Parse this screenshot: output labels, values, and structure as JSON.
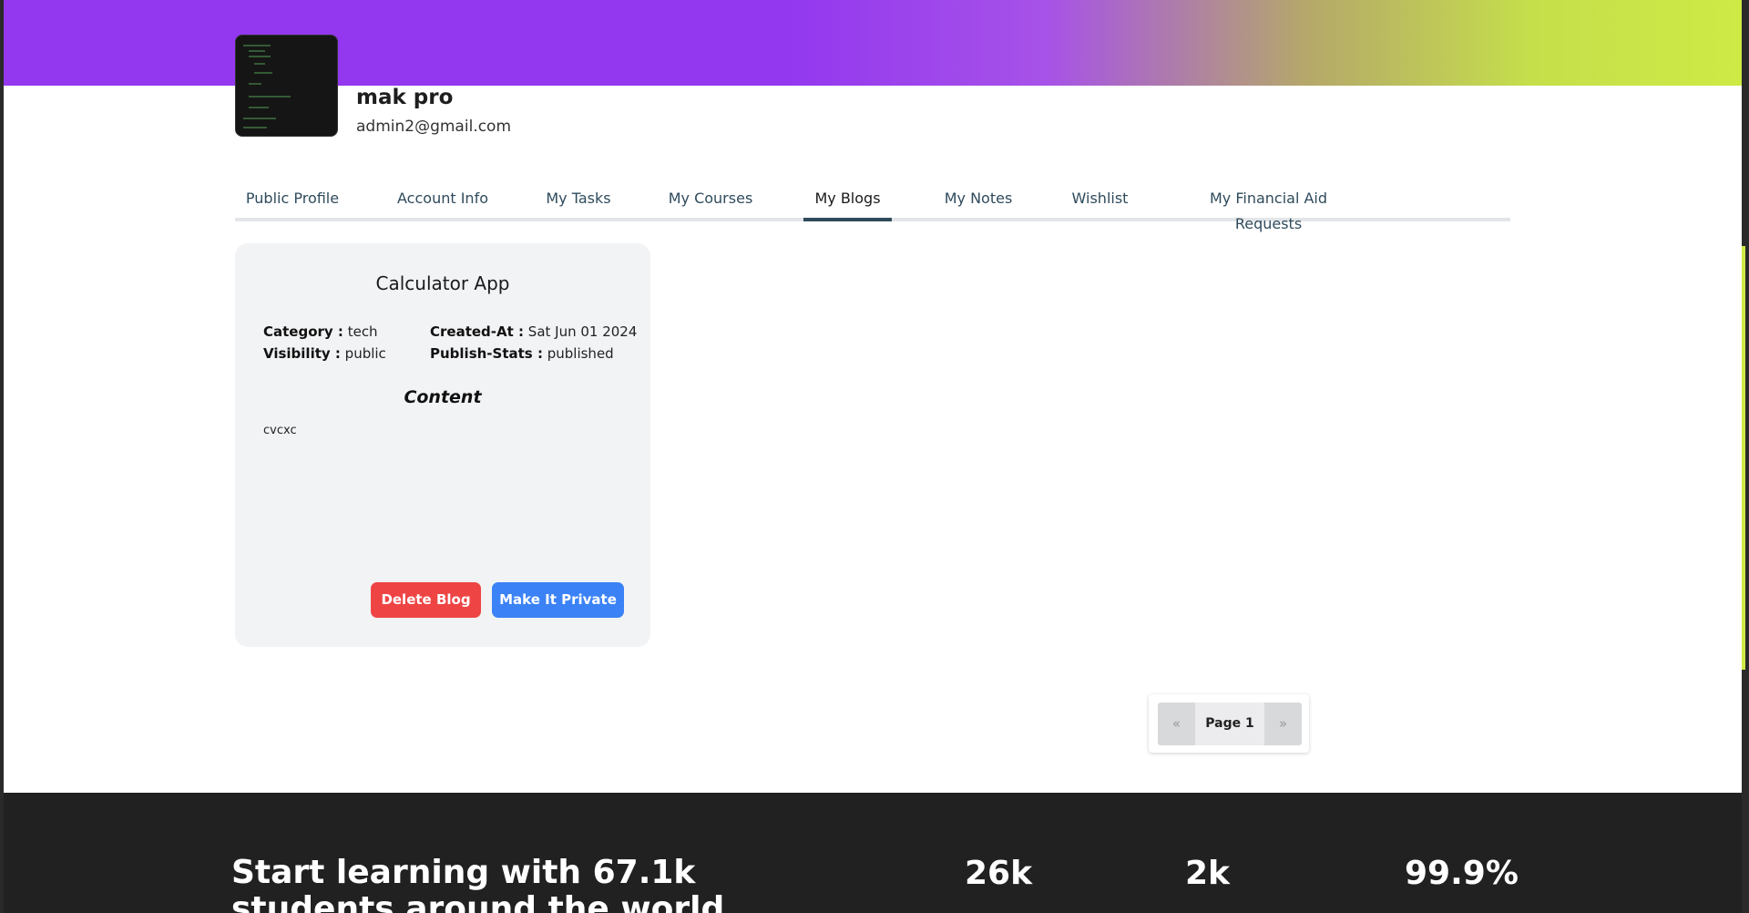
{
  "profile": {
    "name": "mak pro",
    "email": "admin2@gmail.com"
  },
  "tabs": [
    {
      "label": "Public Profile",
      "active": false
    },
    {
      "label": "Account Info",
      "active": false
    },
    {
      "label": "My Tasks",
      "active": false
    },
    {
      "label": "My Courses",
      "active": false
    },
    {
      "label": "My Blogs",
      "active": true
    },
    {
      "label": "My Notes",
      "active": false
    },
    {
      "label": "Wishlist",
      "active": false
    },
    {
      "label": "My Financial Aid Requests",
      "active": false
    }
  ],
  "blog": {
    "title": "Calculator App",
    "category_label": "Category :",
    "category": "tech",
    "visibility_label": "Visibility :",
    "visibility": "public",
    "created_label": "Created-At :",
    "created": "Sat Jun 01 2024",
    "publish_label": "Publish-Stats :",
    "publish": "published",
    "content_heading": "Content",
    "content": "cvcxc",
    "delete_label": "Delete Blog",
    "private_label": "Make It Private"
  },
  "pagination": {
    "prev": "«",
    "page_label": "Page 1",
    "next": "»"
  },
  "footer": {
    "heading": "Start learning with 67.1k students around the world",
    "stats": [
      {
        "value": "26k"
      },
      {
        "value": "2k"
      },
      {
        "value": "99.9%"
      }
    ]
  },
  "colors": {
    "banner_start": "#9338ef",
    "banner_end": "#cdea45",
    "delete": "#ef4444",
    "primary": "#3b82f6",
    "tab_active": "#2f4b5c",
    "footer_bg": "#212121"
  }
}
